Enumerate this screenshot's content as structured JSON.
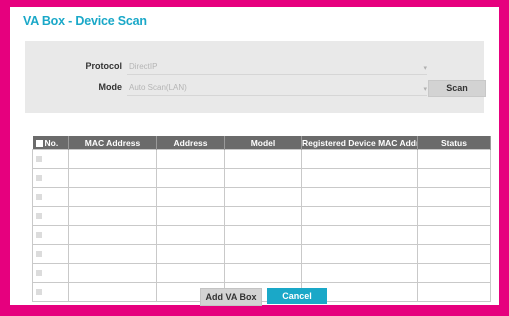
{
  "dialog": {
    "title": "VA Box - Device Scan"
  },
  "options": {
    "protocol_label": "Protocol",
    "protocol_value": "DirectIP",
    "mode_label": "Mode",
    "mode_value": "Auto Scan(LAN)",
    "scan_label": "Scan"
  },
  "table": {
    "headers": [
      "No.",
      "MAC Address",
      "Address",
      "Model",
      "Registered Device MAC Address",
      "Status"
    ],
    "row_count": 8
  },
  "footer": {
    "add_label": "Add VA Box",
    "cancel_label": "Cancel"
  },
  "colors": {
    "frame": "#e6007e",
    "accent": "#1aa8c8",
    "header_bg": "#6b6b6b"
  }
}
